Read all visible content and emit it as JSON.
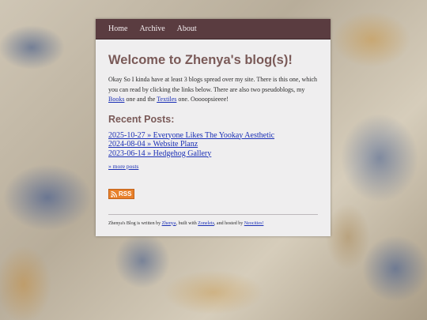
{
  "nav": {
    "items": [
      "Home",
      "Archive",
      "About"
    ]
  },
  "page_title": "Welcome to Zhenya's blog(s)!",
  "intro": {
    "part1": "Okay So I kinda have at least 3 blogs spread over my site. There is this one, which you can read by clicking the links below. There are also two pseudoblogs, my ",
    "link_books": "Books",
    "part2": " one and the ",
    "link_textiles": "Textiles",
    "part3": " one. Ooooopsieeee!"
  },
  "recent_heading": "Recent Posts:",
  "posts": [
    "2025-10-27 » Everyone Likes The Yookay Aesthetic",
    "2024-08-04 » Website Planz",
    "2023-06-14 » Hedgehog Gallery"
  ],
  "more_posts": "» more posts",
  "rss_label": "RSS",
  "footer": {
    "part1": "Zhenya's Blog is written by ",
    "link_author": "Zhenya",
    "part2": ", built with ",
    "link_builder": "Zonelets",
    "part3": ", and hosted by ",
    "link_host": "Neocities!"
  },
  "colors": {
    "nav_bg": "#5a3c40",
    "heading": "#7a5a58",
    "link": "#1a2fb5",
    "rss": "#e8802a",
    "page_bg": "#efeeef"
  }
}
